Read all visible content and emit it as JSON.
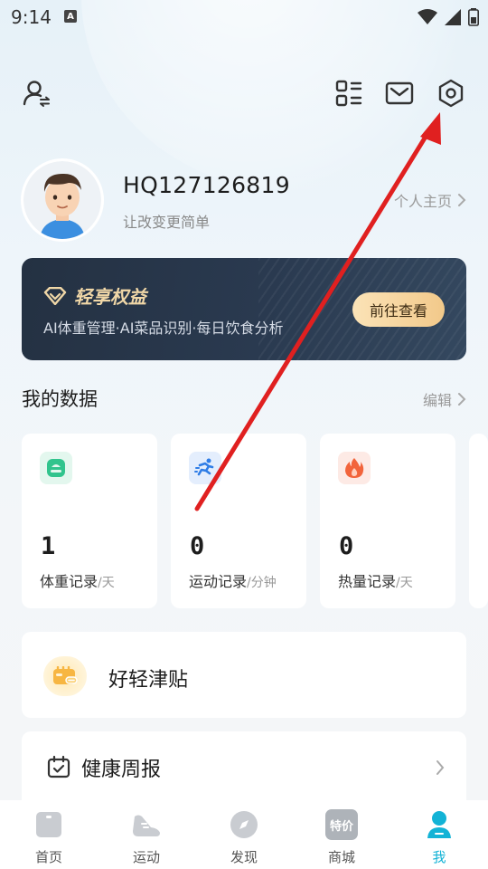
{
  "status_bar": {
    "time": "9:14",
    "notification": "A"
  },
  "profile": {
    "username": "HQ127126819",
    "tagline": "让改变更简单",
    "homepage_link": "个人主页"
  },
  "banner": {
    "title": "轻享权益",
    "description": "AI体重管理·AI菜品识别·每日饮食分析",
    "button": "前往查看"
  },
  "my_data": {
    "title": "我的数据",
    "edit": "编辑",
    "cards": [
      {
        "value": "1",
        "label": "体重记录",
        "unit": "/天",
        "icon": "scale-icon"
      },
      {
        "value": "0",
        "label": "运动记录",
        "unit": "/分钟",
        "icon": "running-icon"
      },
      {
        "value": "0",
        "label": "热量记录",
        "unit": "/天",
        "icon": "flame-icon"
      }
    ]
  },
  "list": {
    "haoqingjintie": "好轻津贴",
    "health_report": "健康周报"
  },
  "bottom_nav": [
    {
      "label": "首页",
      "icon": "home-icon"
    },
    {
      "label": "运动",
      "icon": "shoe-icon"
    },
    {
      "label": "发现",
      "icon": "compass-icon"
    },
    {
      "label": "商城",
      "icon": "shop-icon",
      "badge": "特价"
    },
    {
      "label": "我",
      "icon": "person-icon",
      "active": true
    }
  ],
  "colors": {
    "accent": "#13b3d6",
    "banner_bg": "#243142",
    "arrow": "#e02020"
  }
}
